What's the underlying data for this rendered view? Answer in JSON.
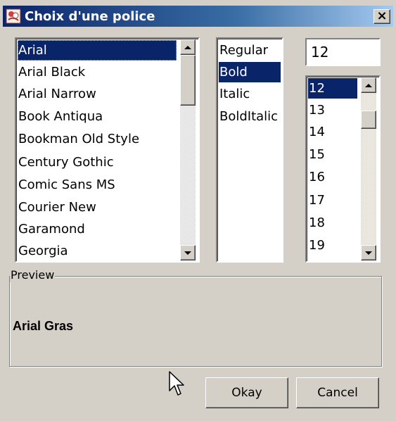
{
  "window": {
    "title": "Choix d'une police",
    "close_label": "×",
    "app_icon": "font-chooser-icon"
  },
  "font_list": {
    "items": [
      "Arial",
      "Arial Black",
      "Arial Narrow",
      "Book Antiqua",
      "Bookman Old Style",
      "Century Gothic",
      "Comic Sans MS",
      "Courier New",
      "Garamond",
      "Georgia"
    ],
    "selected": "Arial"
  },
  "style_list": {
    "items": [
      "Regular",
      "Bold",
      "Italic",
      "BoldItalic"
    ],
    "selected": "Bold"
  },
  "size": {
    "input_value": "12",
    "items": [
      "12",
      "13",
      "14",
      "15",
      "16",
      "17",
      "18",
      "19"
    ],
    "selected": "12"
  },
  "preview": {
    "legend": "Preview",
    "sample_text": "Arial Gras"
  },
  "buttons": {
    "okay": "Okay",
    "cancel": "Cancel"
  },
  "colors": {
    "dialog_bg": "#d4d0c8",
    "selection": "#0a246a",
    "title_gradient_start": "#0a246a",
    "title_gradient_end": "#a6caf0"
  }
}
